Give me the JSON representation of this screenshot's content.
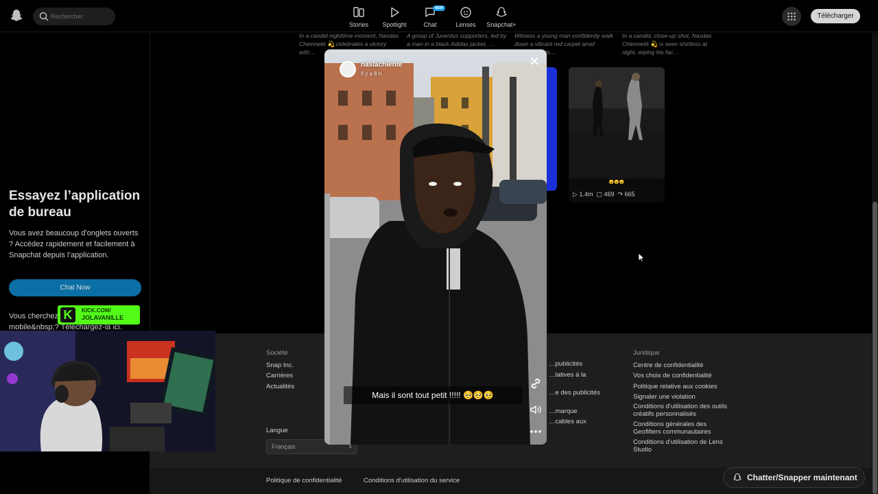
{
  "topbar": {
    "search_placeholder": "Rechercher",
    "nav": [
      {
        "label": "Stories",
        "icon": "stories-icon"
      },
      {
        "label": "Spotlight",
        "icon": "play-icon"
      },
      {
        "label": "Chat",
        "icon": "chat-icon",
        "badge": "NEW"
      },
      {
        "label": "Lenses",
        "icon": "lenses-icon"
      },
      {
        "label": "Snapchat+",
        "icon": "ghost-icon"
      }
    ],
    "download_label": "Télécharger"
  },
  "left_panel": {
    "promo_title": "Essayez l’application de bureau",
    "promo_text": "Vous avez beaucoup d’onglets ouverts ? Accédez rapidement et facilement à Snapchat depuis l’application.",
    "chat_now_label": "Chat Now",
    "mobile_text": "Vous cherchez l’application mobile&nbsp;? Téléchargez-la",
    "mobile_link": "ici",
    "mobile_suffix": "."
  },
  "captions": [
    "In a candid nighttime moment, Nasdas Chienneté 💫 celebrates a victory with…",
    "A group of Juventus supporters, led by a man in a black Adidas jacket, …",
    "Witness a young man confidently walk down a vibrant red carpet amid flashing lights.…",
    "In a candid, close-up shot, Nasdas Chienneté 💫 is seen shirtless at night, wiping his fac…"
  ],
  "tile": {
    "views": "1.4m",
    "comments": "469",
    "shares": "665",
    "emojis": "😮😮😮"
  },
  "story": {
    "username": "naslachiente",
    "time": "Il y a 8 h",
    "subtitle": "Mais il sont tout petit !!!!! 🥺🥺🥺"
  },
  "footer": {
    "columns": [
      {
        "heading": "Société",
        "links": [
          "Snap Inc.",
          "Carrières",
          "Actualités"
        ]
      },
      {
        "heading": "",
        "links": [
          "…publicités",
          "…latives à la",
          "",
          "…e des publicités",
          "",
          "…marque",
          "…cables aux"
        ]
      },
      {
        "heading": "Juridique",
        "links": [
          "Centre de confidentialité",
          "Vos choix de confidentialité",
          "Politique relative aux cookies",
          "Signaler une violation",
          "Conditions d'utilisation des outils créatifs personnalisés",
          "Conditions générales des Geofilters communautaires",
          "Conditions d'utilisation de Lens Studio"
        ]
      }
    ],
    "language_label": "Langue",
    "language_value": "Français",
    "bottom_links": [
      "Politique de confidentialité",
      "Conditions d'utilisation du service"
    ]
  },
  "chat_float_label": "Chatter/Snapper maintenant",
  "overlay": {
    "kick_line1": "KICK.COM/",
    "kick_line2": "JOLAVANILLE"
  },
  "colors": {
    "accent_blue": "#0b6fa6",
    "kick_green": "#53fc18",
    "badge_blue": "#1ea1f2"
  }
}
